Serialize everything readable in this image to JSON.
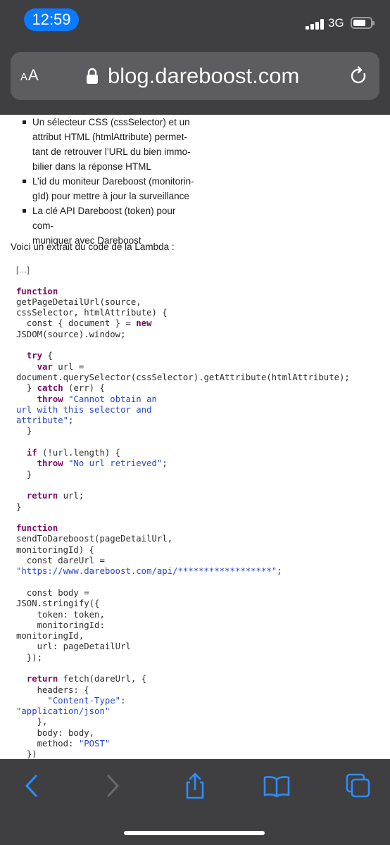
{
  "status_bar": {
    "time": "12:59",
    "network": "3G"
  },
  "address_bar": {
    "reader_label_small": "A",
    "reader_label_large": "A",
    "url": "blog.dareboost.com"
  },
  "article": {
    "bullets": [
      [
        "Un sélecteur CSS (cssSelector) et un",
        "attribut HTML (htmlAttribute) permet-",
        "tant de retrouver l’URL du bien immo-",
        "bilier dans la réponse HTML"
      ],
      [
        "L’id du moniteur Dareboost (monitorin-",
        "gId) pour mettre à jour la surveillance"
      ],
      [
        "La clé API Dareboost (token) pour com-",
        "muniquer avec Dareboost"
      ]
    ],
    "intro": "Voici un extrait du code de la Lambda :",
    "code_lines": [
      [
        {
          "t": "[…]",
          "c": "cm"
        }
      ],
      [],
      [
        {
          "t": "function",
          "c": "kw"
        }
      ],
      [
        {
          "t": "getPageDetailUrl(source,",
          "c": ""
        }
      ],
      [
        {
          "t": "cssSelector, htmlAttribute) {",
          "c": ""
        }
      ],
      [
        {
          "t": "  const { document } = ",
          "c": ""
        },
        {
          "t": "new",
          "c": "kw"
        }
      ],
      [
        {
          "t": "JSDOM(source).window;",
          "c": ""
        }
      ],
      [],
      [
        {
          "t": "  ",
          "c": ""
        },
        {
          "t": "try",
          "c": "kw"
        },
        {
          "t": " {",
          "c": ""
        }
      ],
      [
        {
          "t": "    ",
          "c": ""
        },
        {
          "t": "var",
          "c": "kw"
        },
        {
          "t": " url =",
          "c": ""
        }
      ],
      [
        {
          "t": "document.querySelector(cssSelector).getAttribute(htmlAttribute);",
          "c": ""
        }
      ],
      [
        {
          "t": "  } ",
          "c": ""
        },
        {
          "t": "catch",
          "c": "kw"
        },
        {
          "t": " (err) {",
          "c": ""
        }
      ],
      [
        {
          "t": "    ",
          "c": ""
        },
        {
          "t": "throw",
          "c": "kw"
        },
        {
          "t": " ",
          "c": ""
        },
        {
          "t": "\"Cannot obtain an",
          "c": "st"
        }
      ],
      [
        {
          "t": "url with this selector and",
          "c": "st"
        }
      ],
      [
        {
          "t": "attribute\"",
          "c": "st"
        },
        {
          "t": ";",
          "c": ""
        }
      ],
      [
        {
          "t": "  }",
          "c": ""
        }
      ],
      [],
      [
        {
          "t": "  ",
          "c": ""
        },
        {
          "t": "if",
          "c": "kw"
        },
        {
          "t": " (!url.length) {",
          "c": ""
        }
      ],
      [
        {
          "t": "    ",
          "c": ""
        },
        {
          "t": "throw",
          "c": "kw"
        },
        {
          "t": " ",
          "c": ""
        },
        {
          "t": "\"No url retrieved\"",
          "c": "st"
        },
        {
          "t": ";",
          "c": ""
        }
      ],
      [
        {
          "t": "  }",
          "c": ""
        }
      ],
      [],
      [
        {
          "t": "  ",
          "c": ""
        },
        {
          "t": "return",
          "c": "kw"
        },
        {
          "t": " url;",
          "c": ""
        }
      ],
      [
        {
          "t": "}",
          "c": ""
        }
      ],
      [],
      [
        {
          "t": "function",
          "c": "kw"
        }
      ],
      [
        {
          "t": "sendToDareboost(pageDetailUrl,",
          "c": ""
        }
      ],
      [
        {
          "t": "monitoringId) {",
          "c": ""
        }
      ],
      [
        {
          "t": "  const dareUrl =",
          "c": ""
        }
      ],
      [
        {
          "t": "\"https://www.dareboost.com/api/******************\"",
          "c": "st"
        },
        {
          "t": ";",
          "c": ""
        }
      ],
      [],
      [
        {
          "t": "  const body =",
          "c": ""
        }
      ],
      [
        {
          "t": "JSON.stringify({",
          "c": ""
        }
      ],
      [
        {
          "t": "    token: token,",
          "c": ""
        }
      ],
      [
        {
          "t": "    monitoringId:",
          "c": ""
        }
      ],
      [
        {
          "t": "monitoringId,",
          "c": ""
        }
      ],
      [
        {
          "t": "    url: pageDetailUrl",
          "c": ""
        }
      ],
      [
        {
          "t": "  });",
          "c": ""
        }
      ],
      [],
      [
        {
          "t": "  ",
          "c": ""
        },
        {
          "t": "return",
          "c": "kw"
        },
        {
          "t": " fetch(dareUrl, {",
          "c": ""
        }
      ],
      [
        {
          "t": "    headers: {",
          "c": ""
        }
      ],
      [
        {
          "t": "      ",
          "c": ""
        },
        {
          "t": "\"Content-Type\"",
          "c": "st"
        },
        {
          "t": ":",
          "c": ""
        }
      ],
      [
        {
          "t": "\"application/json\"",
          "c": "st"
        }
      ],
      [
        {
          "t": "    },",
          "c": ""
        }
      ],
      [
        {
          "t": "    body: body,",
          "c": ""
        }
      ],
      [
        {
          "t": "    method: ",
          "c": ""
        },
        {
          "t": "\"POST\"",
          "c": "st"
        }
      ],
      [
        {
          "t": "  })",
          "c": ""
        }
      ]
    ]
  },
  "toolbar": {
    "icons": [
      "back-icon",
      "forward-icon",
      "share-icon",
      "bookmarks-icon",
      "tabs-icon"
    ]
  },
  "colors": {
    "chrome": "#3f3f41",
    "accent": "#0a7aff",
    "keyword": "#7a0c63",
    "string": "#2848c4"
  }
}
